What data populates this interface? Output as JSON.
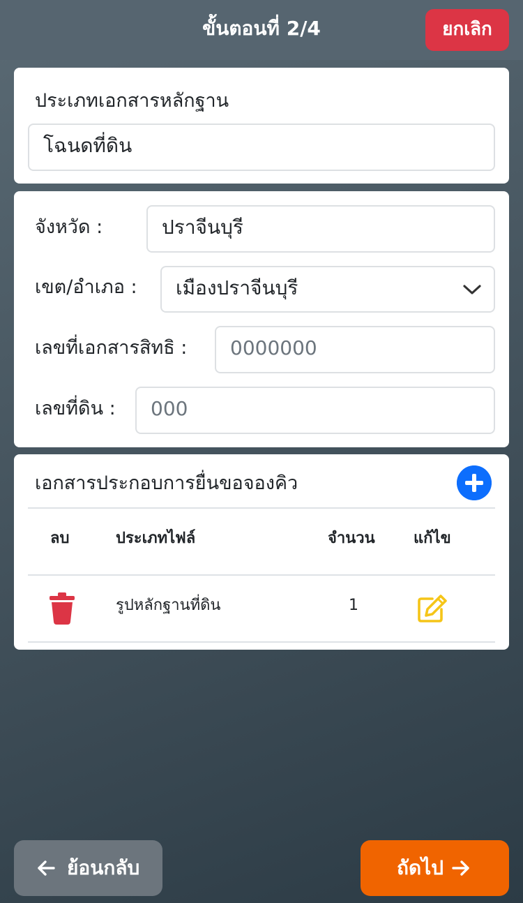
{
  "header": {
    "step_title": "ขั้นตอนที่ 2/4",
    "cancel_label": "ยกเลิก"
  },
  "document_type": {
    "label": "ประเภทเอกสารหลักฐาน",
    "value": "โฉนดที่ดิน"
  },
  "location": {
    "province_label": "จังหวัด :",
    "province_value": "ปราจีนบุรี",
    "district_label": "เขต/อำเภอ :",
    "district_value": "เมืองปราจีนบุรี",
    "deed_no_label": "เลขที่เอกสารสิทธิ :",
    "deed_no_placeholder": "0000000",
    "land_no_label": "เลขที่ดิน :",
    "land_no_placeholder": "000"
  },
  "attachments": {
    "title": "เอกสารประกอบการยื่นขอจองคิว",
    "columns": {
      "delete": "ลบ",
      "file_type": "ประเภทไฟล์",
      "count": "จำนวน",
      "edit": "แก้ไข"
    },
    "rows": [
      {
        "file_type": "รูปหลักฐานที่ดิน",
        "count": "1"
      }
    ]
  },
  "footer": {
    "back_label": "ย้อนกลับ",
    "next_label": "ถัดไป"
  },
  "icons": {
    "add": "plus-circle-icon",
    "delete": "trash-icon",
    "edit": "edit-icon",
    "back": "arrow-left-icon",
    "next": "arrow-right-icon",
    "dropdown": "chevron-down-icon"
  },
  "colors": {
    "danger": "#dc3545",
    "primary": "#0d6efd",
    "accent_orange": "#f06400",
    "edit_yellow": "#f5c518",
    "secondary": "#6c757d"
  }
}
